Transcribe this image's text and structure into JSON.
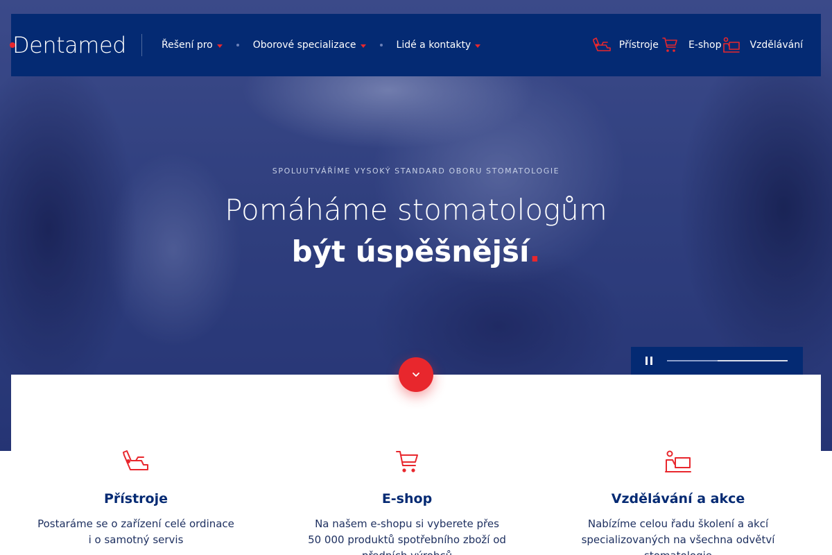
{
  "brand": {
    "name": "Dentamed",
    "accent": "#e8272d",
    "navy": "#042a73"
  },
  "nav": {
    "items": [
      {
        "label": "Řešení pro"
      },
      {
        "label": "Oborové specializace"
      },
      {
        "label": "Lidé a kontakty"
      }
    ]
  },
  "quicklinks": [
    {
      "label": "Přístroje",
      "icon": "dental-chair-icon"
    },
    {
      "label": "E-shop",
      "icon": "cart-icon"
    },
    {
      "label": "Vzdělávání",
      "icon": "presentation-icon"
    }
  ],
  "hero": {
    "eyebrow": "SPOLUUTVÁŘÍME VYSOKÝ STANDARD OBORU STOMATOLOGIE",
    "headline_line1": "Pomáháme stomatologům",
    "headline_line2": "být úspěšnější",
    "headline_dot": ".",
    "slider": {
      "state": "playing",
      "progress": 0.42
    }
  },
  "features": [
    {
      "icon": "dental-chair-icon",
      "title": "Přístroje",
      "desc_line1": "Postaráme se o zařízení celé ordinace",
      "desc_line2": "i o samotný servis",
      "desc_line3": ""
    },
    {
      "icon": "cart-icon",
      "title": "E-shop",
      "desc_line1": "Na našem e-shopu si vyberete přes",
      "desc_line2": "50 000 produktů spotřebního zboží od",
      "desc_line3": "předních výrobců"
    },
    {
      "icon": "presentation-icon",
      "title": "Vzdělávání a akce",
      "desc_line1": "Nabízíme celou řadu školení a akcí",
      "desc_line2": "specializovaných na všechna odvětví",
      "desc_line3": "stomatologie"
    }
  ]
}
